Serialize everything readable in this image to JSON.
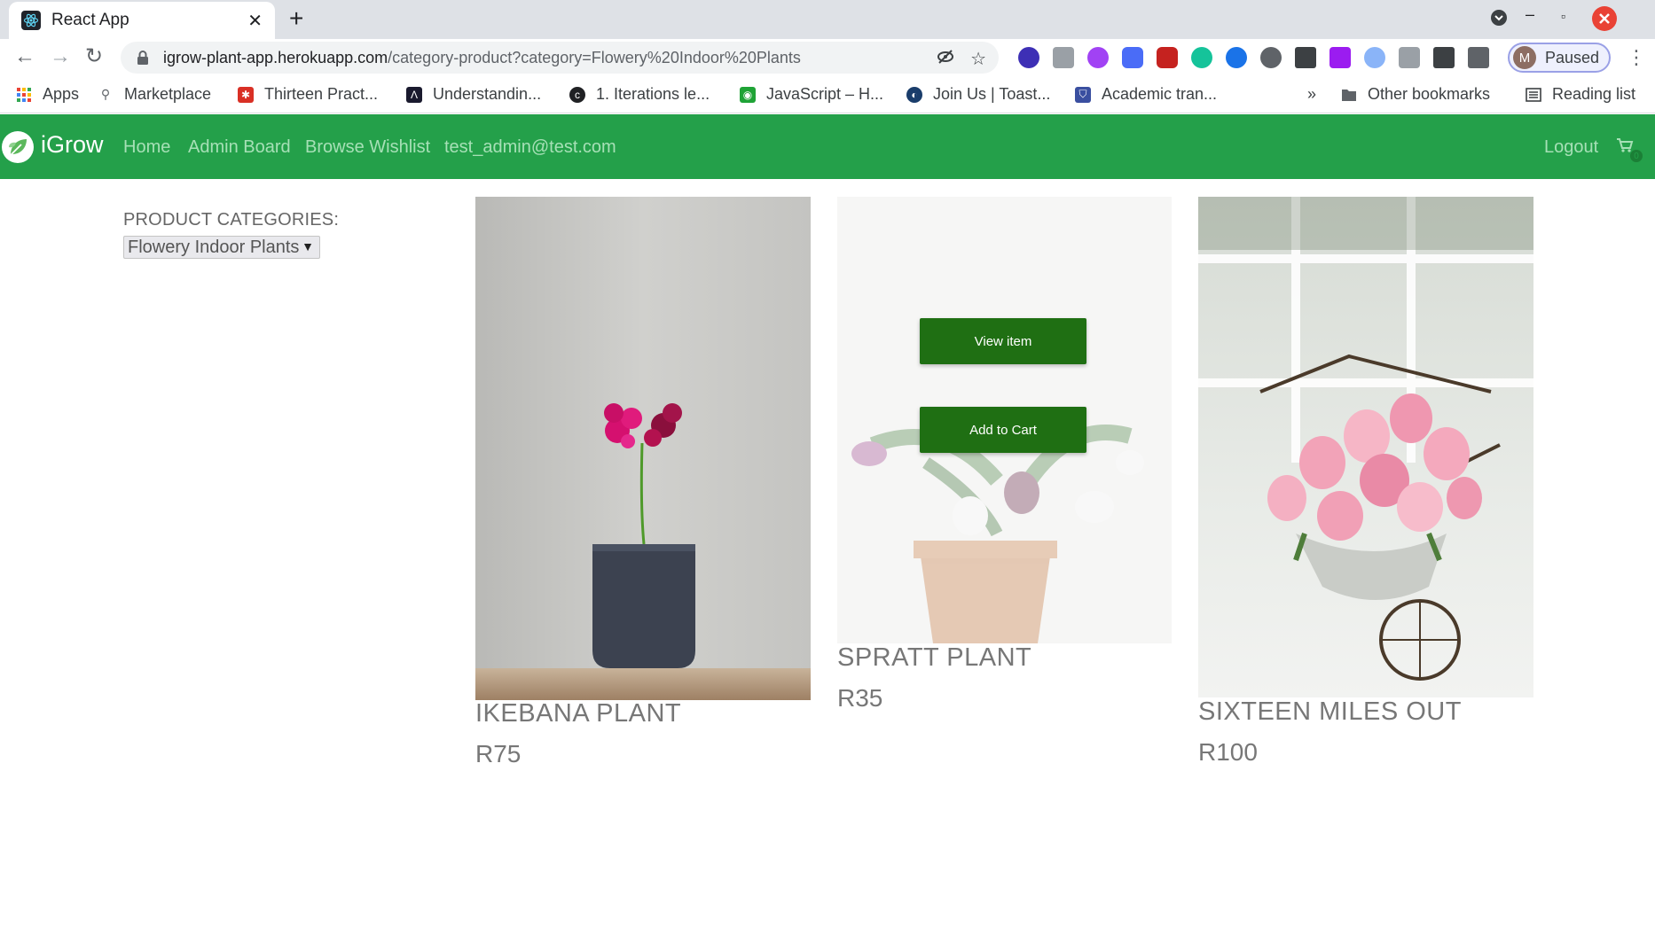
{
  "browser": {
    "tab_title": "React App",
    "new_tab_symbol": "+",
    "url_host": "igrow-plant-app.herokuapp.com",
    "url_path": "/category-product?category=Flowery%20Indoor%20Plants",
    "profile_initial": "M",
    "profile_status": "Paused",
    "bookmarks": [
      {
        "label": "Apps"
      },
      {
        "label": "Marketplace"
      },
      {
        "label": "Thirteen Pract..."
      },
      {
        "label": "Understandin..."
      },
      {
        "label": "1. Iterations le..."
      },
      {
        "label": "JavaScript – H..."
      },
      {
        "label": "Join Us | Toast..."
      },
      {
        "label": "Academic tran..."
      }
    ],
    "bookmarks_overflow": "»",
    "other_bookmarks": "Other bookmarks",
    "reading_list": "Reading list"
  },
  "nav": {
    "brand": "iGrow",
    "links": [
      "Home",
      "Admin Board",
      "Browse Wishlist",
      "test_admin@test.com"
    ],
    "logout": "Logout",
    "cart_count": "0"
  },
  "sidebar": {
    "label": "PRODUCT CATEGORIES:",
    "selected_category": "Flowery Indoor Plants"
  },
  "products": [
    {
      "name": "IKEBANA PLANT",
      "price": "R75"
    },
    {
      "name": "SPRATT PLANT",
      "price": "R35",
      "hover": true,
      "view_label": "View item",
      "cart_label": "Add to Cart"
    },
    {
      "name": "SIXTEEN MILES OUT",
      "price": "R100"
    }
  ],
  "colors": {
    "nav_bg": "#24a04a",
    "nav_link": "#a6e0b6",
    "button_bg": "#1f6f13"
  }
}
